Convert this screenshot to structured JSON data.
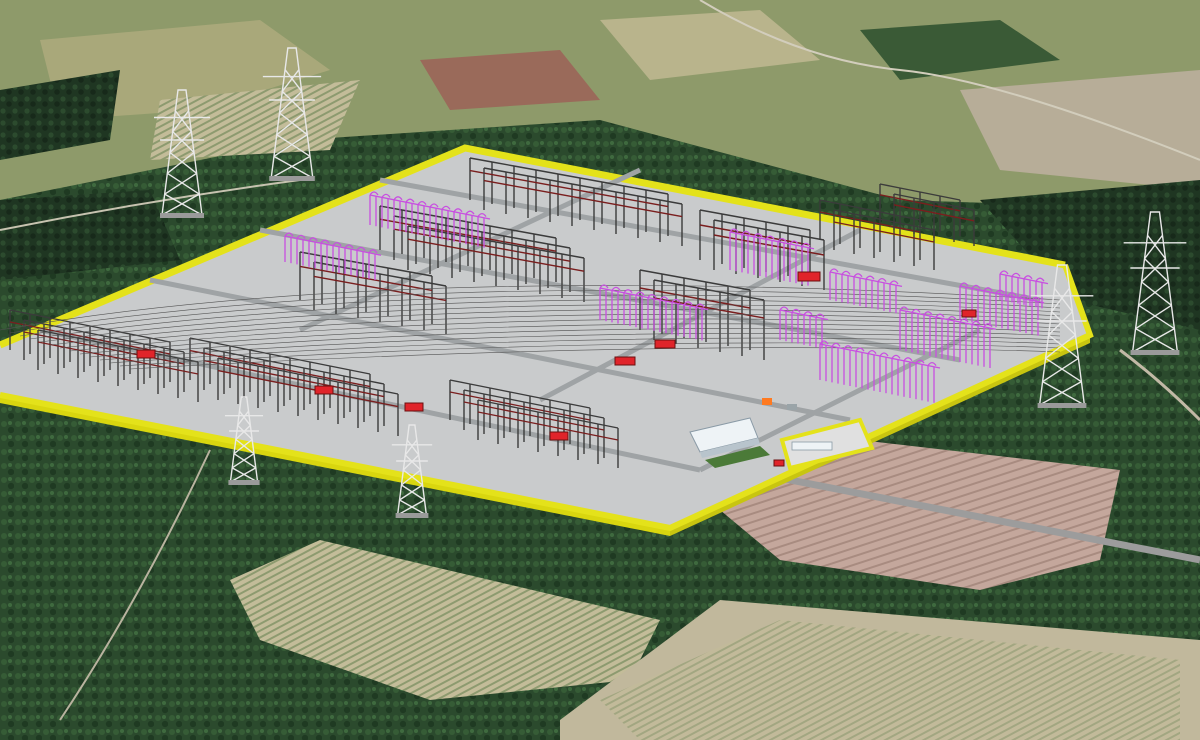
{
  "scene": {
    "subject": "substation-3d-model-over-aerial-terrain",
    "sign_text": "",
    "colors": {
      "pad": "#c9cbcc",
      "border": "#e4e21a",
      "forest": "#2a4a2c",
      "field_light": "#b7b08a",
      "field_pink": "#bfa49a",
      "steel": "#3a3a3a",
      "magenta": "#c84fe0",
      "red_unit": "#e0242a",
      "building": "#dfe6ea",
      "road": "#9a9a9a"
    }
  }
}
